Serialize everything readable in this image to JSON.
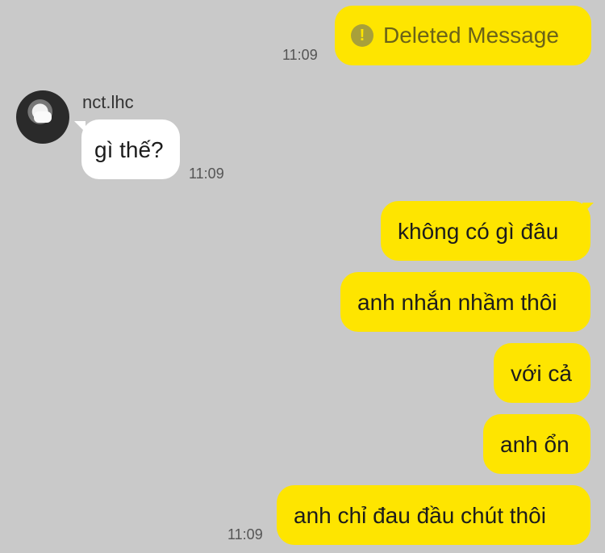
{
  "messages": {
    "deleted": {
      "icon": "warning-icon",
      "text": "Deleted Message",
      "time": "11:09"
    },
    "incoming": {
      "sender": "nct.lhc",
      "text": "gì thế?",
      "time": "11:09"
    },
    "outgoing": [
      {
        "text": "không có gì đâu"
      },
      {
        "text": "anh nhắn nhầm thôi"
      },
      {
        "text": "với cả"
      },
      {
        "text": "anh ổn"
      },
      {
        "text": "anh chỉ đau đầu chút thôi",
        "time": "11:09"
      }
    ]
  },
  "colors": {
    "background": "#c9c9c9",
    "my_bubble": "#fee500",
    "their_bubble": "#ffffff"
  }
}
